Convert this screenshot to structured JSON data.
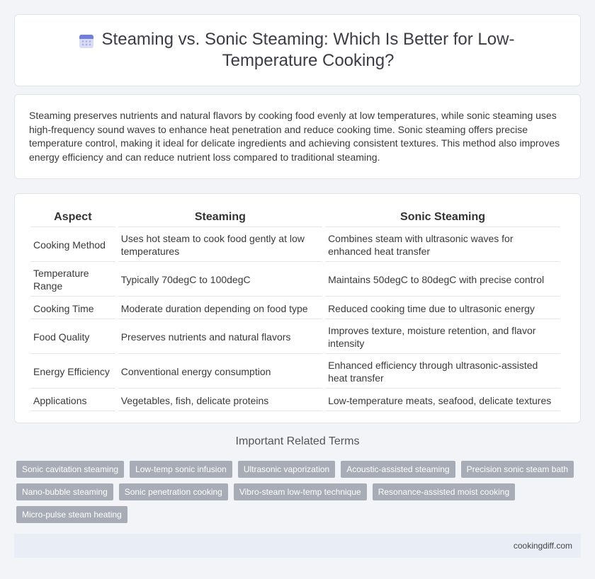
{
  "header": {
    "title": "Steaming vs. Sonic Steaming: Which Is Better for Low-Temperature Cooking?",
    "icon": "calendar-icon"
  },
  "intro": {
    "text": "Steaming preserves nutrients and natural flavors by cooking food evenly at low temperatures, while sonic steaming uses high-frequency sound waves to enhance heat penetration and reduce cooking time. Sonic steaming offers precise temperature control, making it ideal for delicate ingredients and achieving consistent textures. This method also improves energy efficiency and can reduce nutrient loss compared to traditional steaming."
  },
  "table": {
    "headers": [
      "Aspect",
      "Steaming",
      "Sonic Steaming"
    ],
    "rows": [
      [
        "Cooking Method",
        "Uses hot steam to cook food gently at low temperatures",
        "Combines steam with ultrasonic waves for enhanced heat transfer"
      ],
      [
        "Temperature Range",
        "Typically 70degC to 100degC",
        "Maintains 50degC to 80degC with precise control"
      ],
      [
        "Cooking Time",
        "Moderate duration depending on food type",
        "Reduced cooking time due to ultrasonic energy"
      ],
      [
        "Food Quality",
        "Preserves nutrients and natural flavors",
        "Improves texture, moisture retention, and flavor intensity"
      ],
      [
        "Energy Efficiency",
        "Conventional energy consumption",
        "Enhanced efficiency through ultrasonic-assisted heat transfer"
      ],
      [
        "Applications",
        "Vegetables, fish, delicate proteins",
        "Low-temperature meats, seafood, delicate textures"
      ]
    ]
  },
  "related": {
    "title": "Important Related Terms",
    "tags": [
      "Sonic cavitation steaming",
      "Low-temp sonic infusion",
      "Ultrasonic vaporization",
      "Acoustic-assisted steaming",
      "Precision sonic steam bath",
      "Nano-bubble steaming",
      "Sonic penetration cooking",
      "Vibro-steam low-temp technique",
      "Resonance-assisted moist cooking",
      "Micro-pulse steam heating"
    ]
  },
  "footer": {
    "site": "cookingdiff.com"
  }
}
